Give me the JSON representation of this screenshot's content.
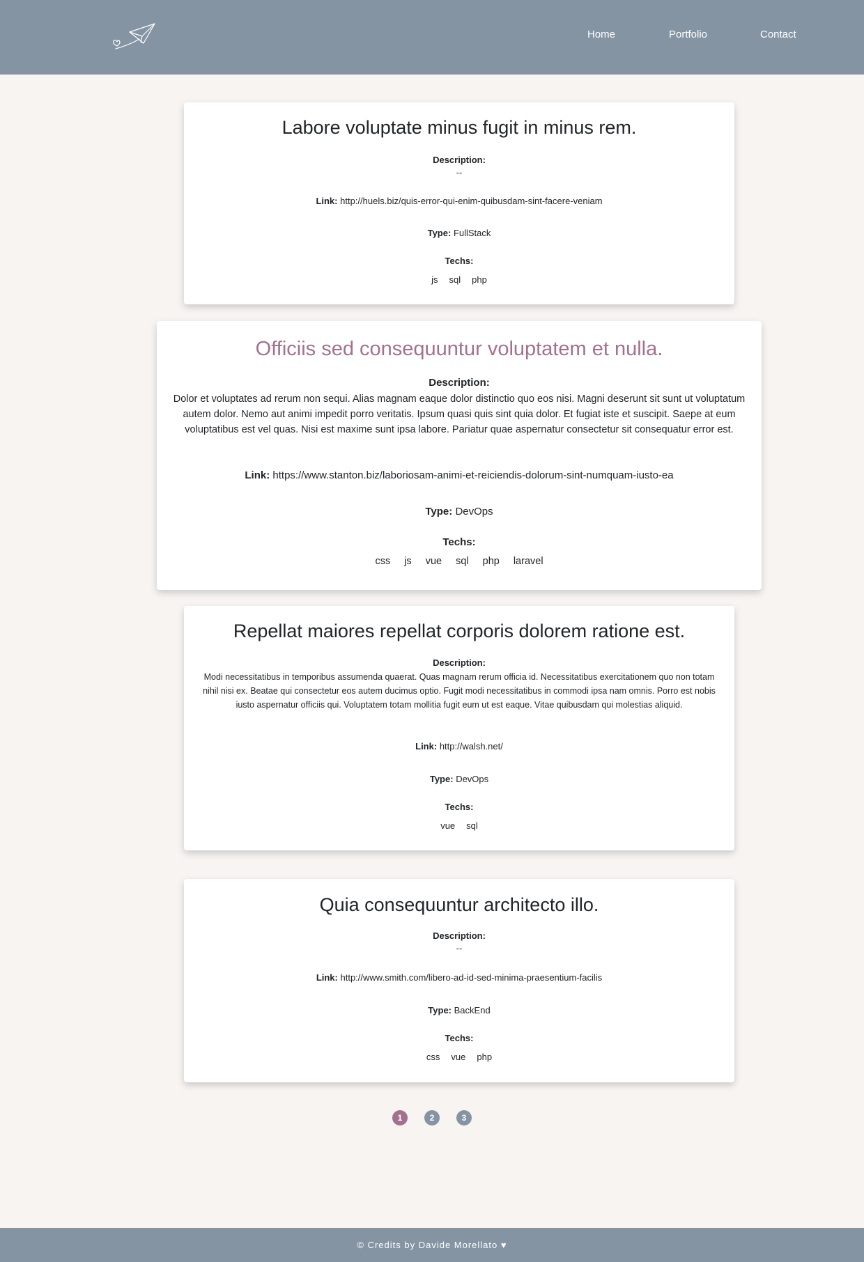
{
  "nav": {
    "home": "Home",
    "portfolio": "Portfolio",
    "contact": "Contact"
  },
  "labels": {
    "description": "Description:",
    "link": "Link:",
    "type": "Type:",
    "techs": "Techs:"
  },
  "projects": [
    {
      "title": "Labore voluptate minus fugit in minus rem.",
      "description": "--",
      "link": "http://huels.biz/quis-error-qui-enim-quibusdam-sint-facere-veniam",
      "type": "FullStack",
      "techs": [
        "js",
        "sql",
        "php"
      ]
    },
    {
      "title": "Officiis sed consequuntur voluptatem et nulla.",
      "description": "Dolor et voluptates ad rerum non sequi. Alias magnam eaque dolor distinctio quo eos nisi. Magni deserunt sit sunt ut voluptatum autem dolor. Nemo aut animi impedit porro veritatis. Ipsum quasi quis sint quia dolor. Et fugiat iste et suscipit. Saepe at eum voluptatibus est vel quas. Nisi est maxime sunt ipsa labore. Pariatur quae aspernatur consectetur sit consequatur error est.",
      "link": "https://www.stanton.biz/laboriosam-animi-et-reiciendis-dolorum-sint-numquam-iusto-ea",
      "type": "DevOps",
      "techs": [
        "css",
        "js",
        "vue",
        "sql",
        "php",
        "laravel"
      ]
    },
    {
      "title": "Repellat maiores repellat corporis dolorem ratione est.",
      "description": "Modi necessitatibus in temporibus assumenda quaerat. Quas magnam rerum officia id. Necessitatibus exercitationem quo non totam nihil nisi ex. Beatae qui consectetur eos autem ducimus optio. Fugit modi necessitatibus in commodi ipsa nam omnis. Porro est nobis iusto aspernatur officiis qui. Voluptatem totam mollitia fugit eum ut est eaque. Vitae quibusdam qui molestias aliquid.",
      "link": "http://walsh.net/",
      "type": "DevOps",
      "techs": [
        "vue",
        "sql"
      ]
    },
    {
      "title": "Quia consequuntur architecto illo.",
      "description": "--",
      "link": "http://www.smith.com/libero-ad-id-sed-minima-praesentium-facilis",
      "type": "BackEnd",
      "techs": [
        "css",
        "vue",
        "php"
      ]
    }
  ],
  "pagination": {
    "pages": [
      "1",
      "2",
      "3"
    ],
    "current": 1
  },
  "footer": {
    "text": "© Credits by Davide Morellato ♥"
  },
  "colors": {
    "header_bg": "#8594a3",
    "accent": "#a4708f",
    "page_bg": "#f7f4f2"
  },
  "icons": {
    "logo": "paper-plane-heart-icon"
  }
}
